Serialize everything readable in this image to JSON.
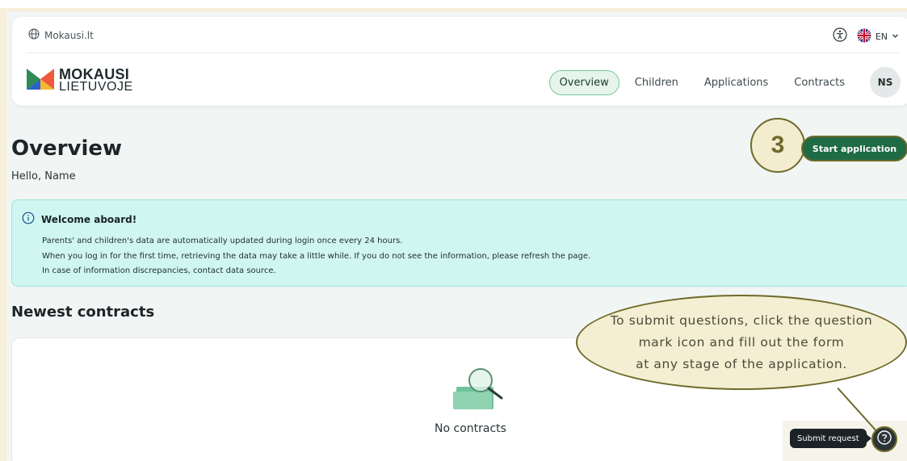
{
  "header": {
    "site_link": "Mokausi.lt",
    "language": "EN",
    "logo_line1": "MOKAUSI",
    "logo_line2": "LIETUVOJE",
    "nav": [
      {
        "label": "Overview",
        "active": true
      },
      {
        "label": "Children",
        "active": false
      },
      {
        "label": "Applications",
        "active": false
      },
      {
        "label": "Contracts",
        "active": false
      }
    ],
    "avatar_initials": "NS"
  },
  "page": {
    "title": "Overview",
    "greeting": "Hello, Name",
    "start_button": "Start application"
  },
  "alert": {
    "title": "Welcome aboard!",
    "lines": [
      "Parents' and children's data are automatically updated during login once every 24 hours.",
      "When you log in for the first time, retrieving the data may take a little while. If you do not see the information, please refresh the page.",
      "In case of information discrepancies, contact data source."
    ]
  },
  "contracts": {
    "section_title": "Newest contracts",
    "empty_text": "No contracts"
  },
  "tour": {
    "step_number": "3",
    "callout_lines": [
      "To submit questions, click the question",
      "mark icon and fill out the form",
      "at any stage of the application."
    ]
  },
  "help": {
    "tooltip": "Submit request"
  },
  "colors": {
    "brand_green": "#1f6b45",
    "alert_bg": "#cff6f1",
    "callout_bg": "#f4efd2",
    "callout_border": "#6f6a2a"
  },
  "icons": [
    "globe-icon",
    "accessibility-icon",
    "uk-flag-icon",
    "chevron-down-icon",
    "info-icon",
    "magnifier-folder-icon",
    "question-mark-icon"
  ]
}
